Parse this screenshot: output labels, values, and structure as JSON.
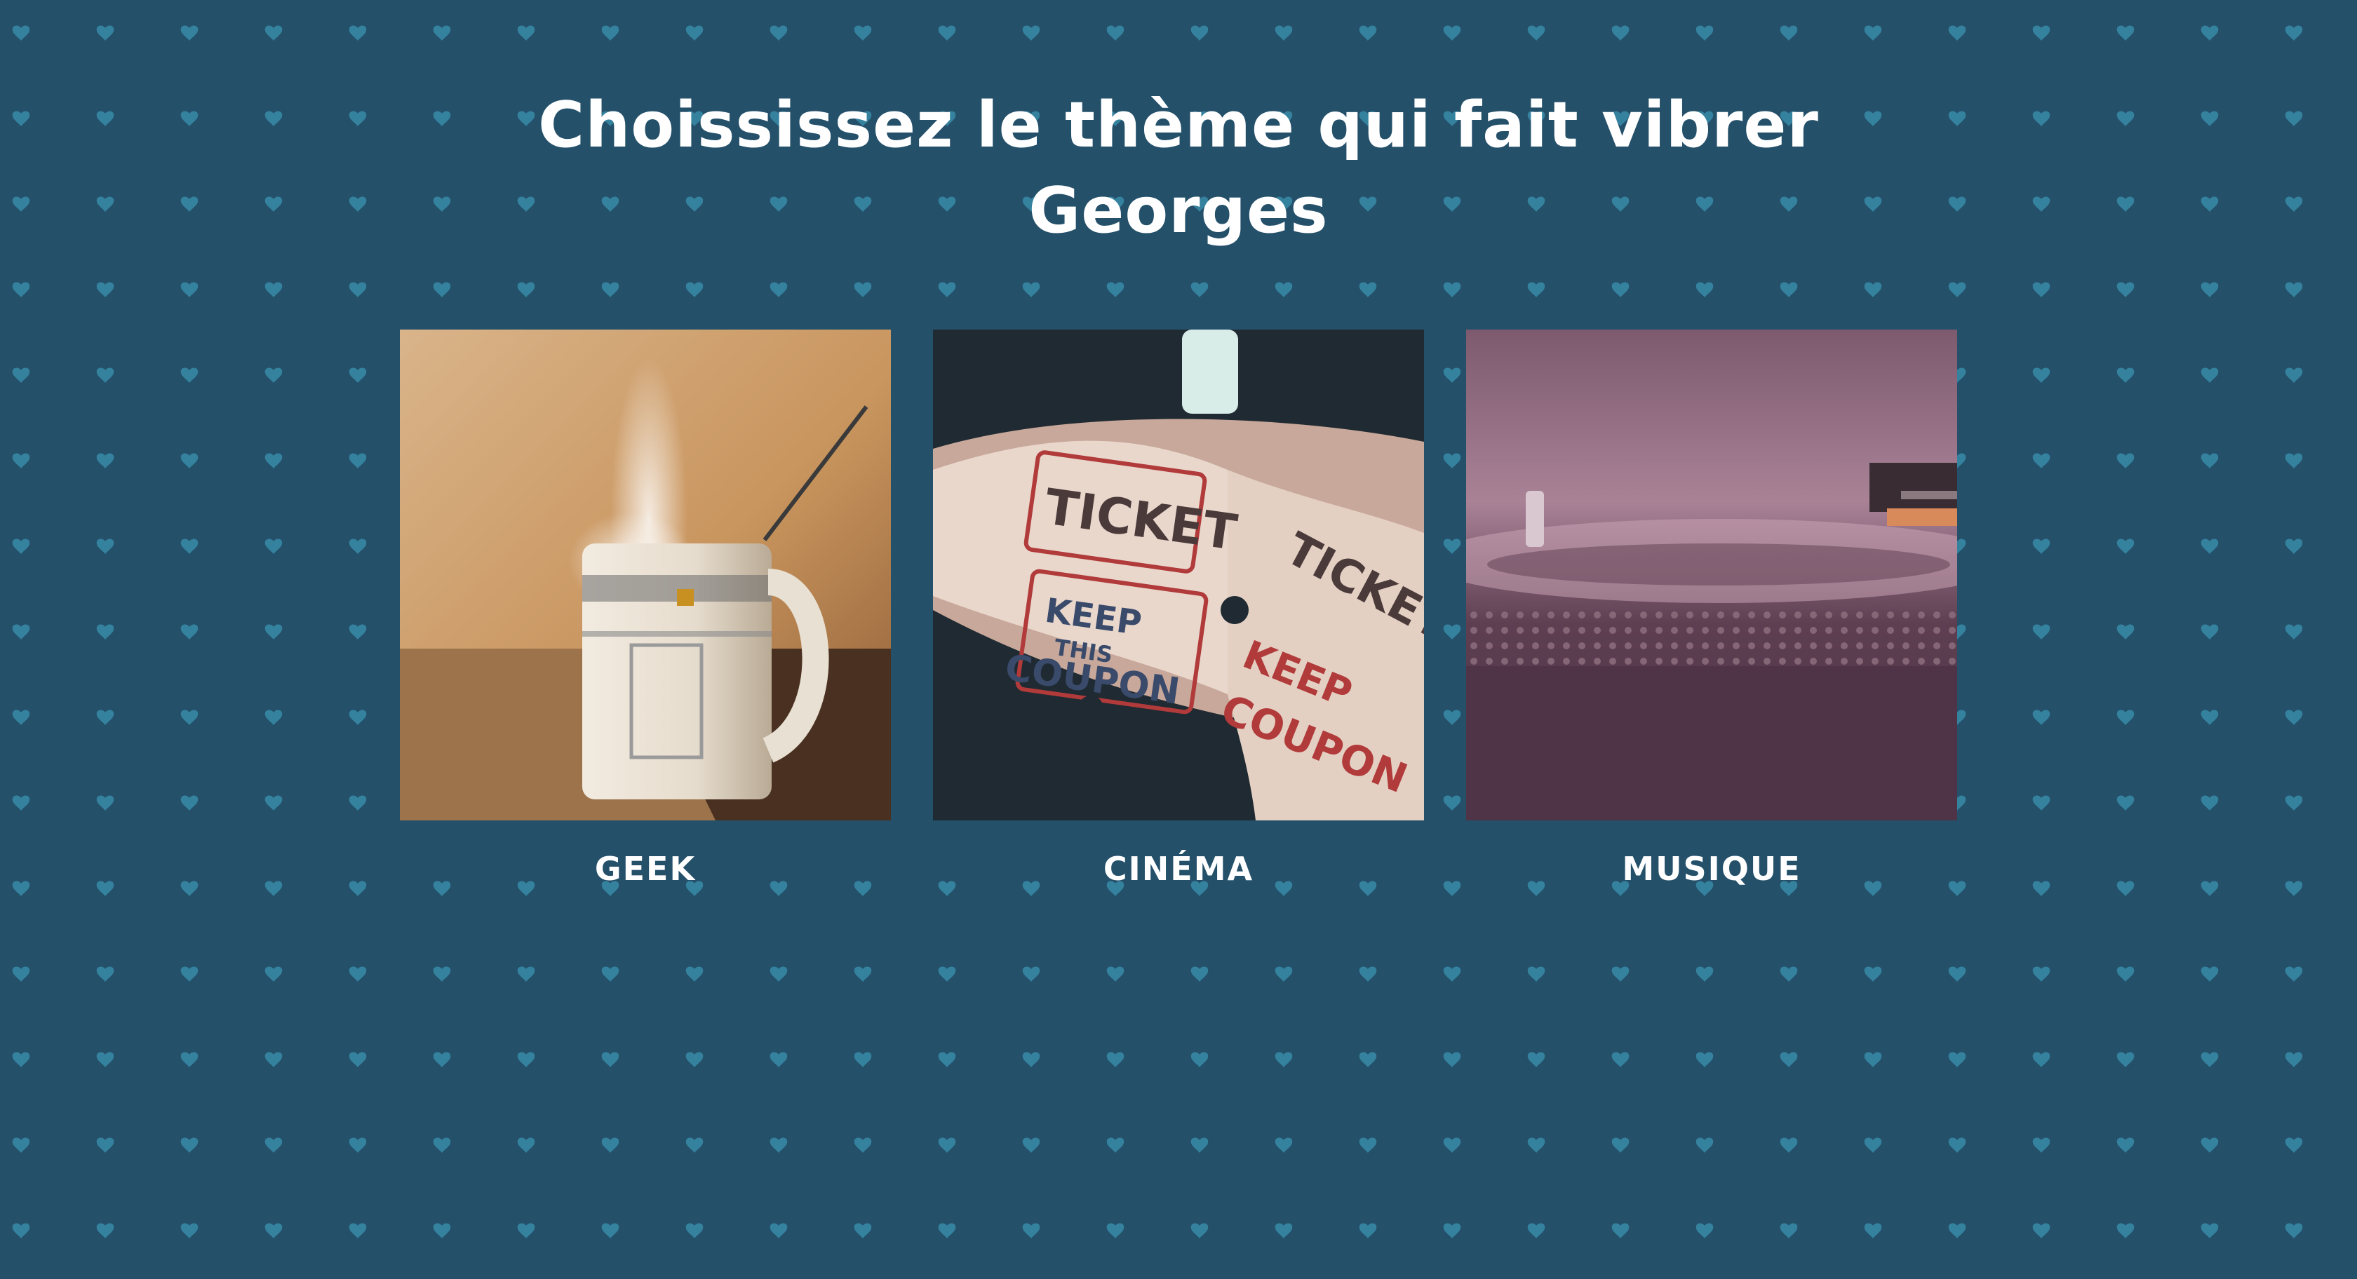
{
  "page": {
    "title": "Choississez le thème qui fait vibrer Georges"
  },
  "themes": [
    {
      "label": "GEEK",
      "image": "steaming-mug-photo"
    },
    {
      "label": "CINÉMA",
      "image": "cinema-tickets-photo"
    },
    {
      "label": "MUSIQUE",
      "image": "record-player-photo"
    }
  ],
  "colors": {
    "background": "#24506a",
    "pattern": "#3fa0be",
    "text": "#ffffff"
  }
}
